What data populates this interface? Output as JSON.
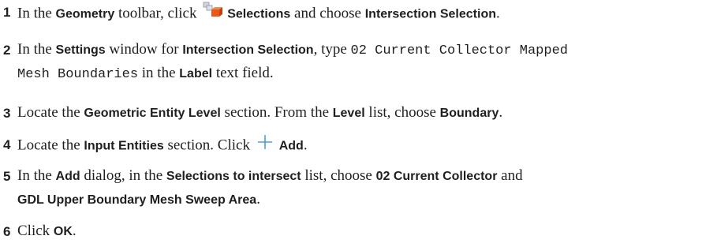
{
  "steps": [
    {
      "number": "1",
      "t1": "In the ",
      "b1": "Geometry",
      "t2": " toolbar, click ",
      "icon": "selections-icon",
      "b2": "Selections",
      "t3": " and choose ",
      "b3": "Intersection Selection",
      "t4": "."
    },
    {
      "number": "2",
      "t1": "In the ",
      "b1": "Settings",
      "t2": " window for ",
      "b2": "Intersection Selection",
      "t3": ", type ",
      "m1": "02 Current Collector Mapped",
      "m2": "Mesh Boundaries",
      "t4": " in the ",
      "b3": "Label",
      "t5": " text field."
    },
    {
      "number": "3",
      "t1": "Locate the ",
      "b1": "Geometric Entity Level",
      "t2": " section. From the ",
      "b2": "Level",
      "t3": " list, choose ",
      "b3": "Boundary",
      "t4": "."
    },
    {
      "number": "4",
      "t1": "Locate the ",
      "b1": "Input Entities",
      "t2": " section. Click ",
      "icon": "plus-icon",
      "b2": "Add",
      "t3": "."
    },
    {
      "number": "5",
      "t1": "In the ",
      "b1": "Add",
      "t2": " dialog, in the ",
      "b2": "Selections to intersect",
      "t3": " list, choose ",
      "b3": "02 Current Collector",
      "t4": " and",
      "b4": "GDL Upper Boundary Mesh Sweep Area",
      "t5": "."
    },
    {
      "number": "6",
      "t1": "Click ",
      "b1": "OK",
      "t2": "."
    }
  ],
  "colors": {
    "text": "#1f1f1f",
    "plus_icon": "#4a9fd8",
    "selection_icon_accent": "#e8581c"
  }
}
